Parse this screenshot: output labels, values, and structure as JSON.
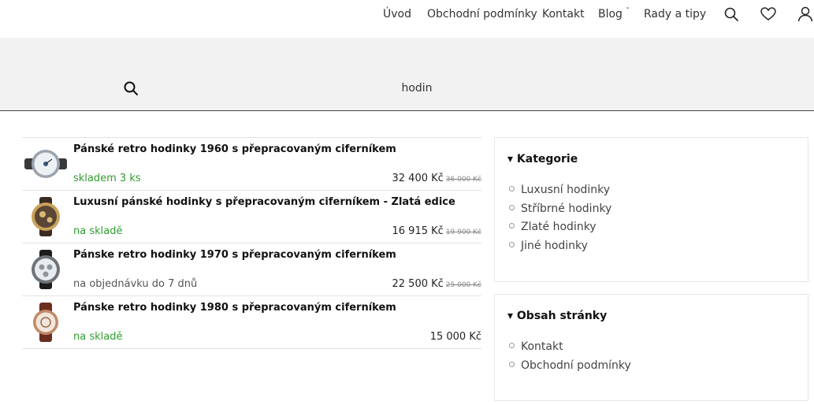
{
  "nav": {
    "items": [
      "Úvod",
      "Obchodní podmínky",
      "Kontakt",
      "Blog",
      "Rady a tipy"
    ],
    "icons": [
      "search-icon",
      "heart-icon",
      "user-icon"
    ]
  },
  "search": {
    "value": "hodin"
  },
  "results": [
    {
      "title": "Pánské retro hodinky 1960 s přepracovaným ciferníkem",
      "stock": "skladem 3 ks",
      "stock_color": "#2e9e2e",
      "price": "32 400 Kč",
      "old_price": "36 000 Kč"
    },
    {
      "title": "Luxusní pánské hodinky s přepracovaným ciferníkem - Zlatá edice",
      "stock": "na skladě",
      "stock_color": "#2e9e2e",
      "price": "16 915 Kč",
      "old_price": "19 900 Kč"
    },
    {
      "title": "Pánske retro hodinky 1970 s přepracovaným ciferníkem",
      "stock": "na objednávku do 7 dnů",
      "stock_color": "#555555",
      "price": "22 500 Kč",
      "old_price": "25 000 Kč"
    },
    {
      "title": "Pánske retro hodinky 1980 s přepracovaným ciferníkem",
      "stock": "na skladě",
      "stock_color": "#2e9e2e",
      "price": "15 000 Kč",
      "old_price": ""
    }
  ],
  "sidebar": {
    "categories": {
      "title": "Kategorie",
      "items": [
        "Luxusní hodinky",
        "Stříbrné hodinky",
        "Zlaté hodinky",
        "Jiné hodinky"
      ]
    },
    "pages": {
      "title": "Obsah stránky",
      "items": [
        "Kontakt",
        "Obchodní podmínky"
      ]
    }
  }
}
